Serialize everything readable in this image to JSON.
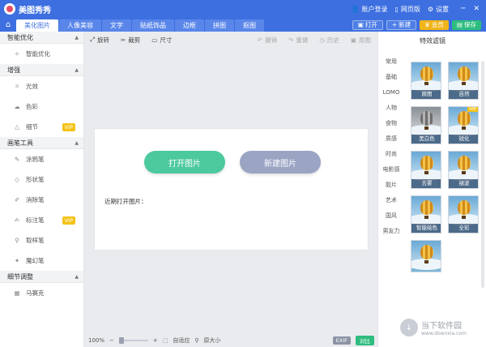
{
  "titlebar": {
    "app_title": "美图秀秀",
    "account": "账户登录",
    "web": "网页版",
    "settings": "设置",
    "min": "─",
    "close": "✕"
  },
  "tabs": [
    {
      "label": "美化图片",
      "active": true
    },
    {
      "label": "人像美容"
    },
    {
      "label": "文字"
    },
    {
      "label": "贴纸饰品"
    },
    {
      "label": "边框"
    },
    {
      "label": "拼图"
    },
    {
      "label": "抠图"
    }
  ],
  "actions": {
    "open": "打开",
    "new": "新建",
    "vip": "会员",
    "save": "保存"
  },
  "sidebar": {
    "sections": [
      {
        "title": "智能优化",
        "items": [
          {
            "label": "智能优化"
          }
        ]
      },
      {
        "title": "增强",
        "items": [
          {
            "label": "光效"
          },
          {
            "label": "色彩"
          },
          {
            "label": "细节",
            "vip": "VIP"
          }
        ]
      },
      {
        "title": "画笔工具",
        "items": [
          {
            "label": "涂鸦笔"
          },
          {
            "label": "形状笔"
          },
          {
            "label": "消除笔"
          },
          {
            "label": "标注笔",
            "vip": "VIP"
          },
          {
            "label": "取样笔"
          },
          {
            "label": "魔幻笔"
          }
        ]
      },
      {
        "title": "细节调整",
        "items": [
          {
            "label": "马赛克"
          }
        ]
      }
    ]
  },
  "toolbar": {
    "rotate": "旋转",
    "crop": "裁剪",
    "size": "尺寸",
    "undo": "撤销",
    "redo": "重做",
    "history": "历史",
    "original": "原图"
  },
  "canvas": {
    "open_label": "打开图片",
    "new_label": "新建图片",
    "recent_label": "近期打开图片："
  },
  "status": {
    "zoom": "100%",
    "fit": "自适应",
    "actual": "原大小",
    "exif": "EXIF",
    "compare": "对比"
  },
  "right_panel": {
    "title": "特效滤镜",
    "categories": [
      "常用",
      "基础",
      "LOMO",
      "人物",
      "食物",
      "质感",
      "时尚",
      "电影感",
      "胶片",
      "艺术",
      "国风",
      "男友力"
    ],
    "filters": [
      {
        "label": "原图"
      },
      {
        "label": "自然"
      },
      {
        "label": "黑白色"
      },
      {
        "label": "锐化",
        "vip": "VIP"
      },
      {
        "label": "去雾"
      },
      {
        "label": "褪波"
      },
      {
        "label": "智能绘色"
      },
      {
        "label": "全彩"
      },
      {
        "label": ""
      }
    ]
  },
  "watermark": {
    "cn": "当下软件园",
    "en": "www.downxia.com"
  }
}
